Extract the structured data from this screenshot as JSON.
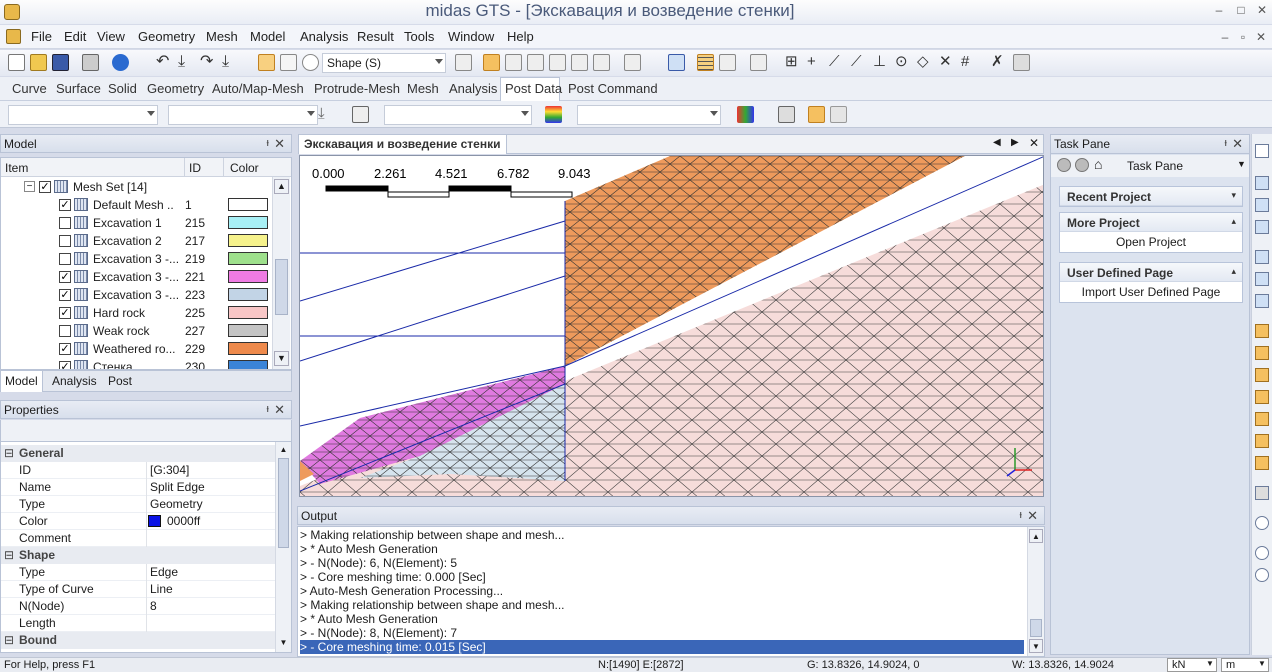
{
  "window": {
    "app_name": "midas GTS",
    "doc_title": " - [Экскавация и возведение стенки]"
  },
  "menu": [
    "File",
    "Edit",
    "View",
    "Geometry",
    "Mesh",
    "Model",
    "Analysis",
    "Result",
    "Tools",
    "Window",
    "Help"
  ],
  "toolbar": {
    "shape_combo": "Shape (S)"
  },
  "tabs": [
    "Curve",
    "Surface",
    "Solid",
    "Geometry",
    "Auto/Map-Mesh",
    "Protrude-Mesh",
    "Mesh",
    "Analysis",
    "Post Data",
    "Post Command"
  ],
  "active_tab": "Post Data",
  "model_panel": {
    "title": "Model",
    "columns": {
      "item": "Item",
      "id": "ID",
      "color": "Color"
    },
    "mesh_set": "Mesh Set [14]",
    "rows": [
      {
        "name": "Default Mesh ..",
        "id": "1",
        "checked": true,
        "color": "#ffffff"
      },
      {
        "name": "Excavation 1",
        "id": "215",
        "checked": false,
        "color": "#a8f0f5"
      },
      {
        "name": "Excavation 2",
        "id": "217",
        "checked": false,
        "color": "#f6f28c"
      },
      {
        "name": "Excavation 3 -...",
        "id": "219",
        "checked": false,
        "color": "#9ee08c"
      },
      {
        "name": "Excavation 3 -...",
        "id": "221",
        "checked": true,
        "color": "#ef7be3"
      },
      {
        "name": "Excavation 3 -...",
        "id": "223",
        "checked": true,
        "color": "#c2d4e6"
      },
      {
        "name": "Hard rock",
        "id": "225",
        "checked": true,
        "color": "#f8c6c6"
      },
      {
        "name": "Weak rock",
        "id": "227",
        "checked": false,
        "color": "#c4c4c4"
      },
      {
        "name": "Weathered ro...",
        "id": "229",
        "checked": true,
        "color": "#ee8a4c"
      },
      {
        "name": "Стенка",
        "id": "230",
        "checked": true,
        "color": "#3a84d8"
      }
    ],
    "bottom_tabs": [
      "Model",
      "Analysis",
      "Post"
    ]
  },
  "properties": {
    "title": "Properties",
    "groups": [
      {
        "name": "General",
        "rows": [
          {
            "k": "ID",
            "v": "[G:304]"
          },
          {
            "k": "Name",
            "v": "Split Edge"
          },
          {
            "k": "Type",
            "v": "Geometry"
          },
          {
            "k": "Color",
            "v": "0000ff"
          },
          {
            "k": "Comment",
            "v": ""
          }
        ]
      },
      {
        "name": "Shape",
        "rows": [
          {
            "k": "Type",
            "v": "Edge"
          },
          {
            "k": "Type of Curve",
            "v": "Line"
          },
          {
            "k": "N(Node)",
            "v": "8"
          },
          {
            "k": "Length",
            "v": ""
          }
        ]
      },
      {
        "name": "Bound",
        "rows": []
      }
    ],
    "color_swatch": "#0a12e6"
  },
  "viewport": {
    "tab_title": "Экскавация и возведение стенки",
    "scale_labels": [
      "0.000",
      "2.261",
      "4.521",
      "6.782",
      "9.043"
    ],
    "colors": {
      "orange": "#ee9a5c",
      "pink": "#f6dcda",
      "magenta": "#e07ae0",
      "lightblue": "#d6e4ee",
      "mesh_line": "#3a3a3a",
      "blue_line": "#1a2aa8"
    }
  },
  "output": {
    "title": "Output",
    "lines": [
      "> Making relationship between shape and mesh...",
      "> * Auto Mesh Generation",
      "> - N(Node): 6, N(Element): 5",
      "> - Core meshing time: 0.000 [Sec]",
      "> Auto-Mesh Generation Processing...",
      "> Making relationship between shape and mesh...",
      "> * Auto Mesh Generation",
      "> - N(Node): 8, N(Element): 7",
      "> - Core meshing time: 0.015 [Sec]"
    ]
  },
  "taskpane": {
    "title": "Task Pane",
    "sub_title": "Task Pane",
    "groups": [
      {
        "header": "Recent Project",
        "items": []
      },
      {
        "header": "More Project",
        "items": [
          "Open Project"
        ]
      },
      {
        "header": "User Defined Page",
        "items": [
          "Import User Defined Page"
        ]
      }
    ]
  },
  "status": {
    "help": "For Help, press F1",
    "counts": "N:[1490] E:[2872]",
    "global": "G: 13.8326, 14.9024, 0",
    "work": "W: 13.8326, 14.9024",
    "force_unit": "kN",
    "length_unit": "m"
  }
}
